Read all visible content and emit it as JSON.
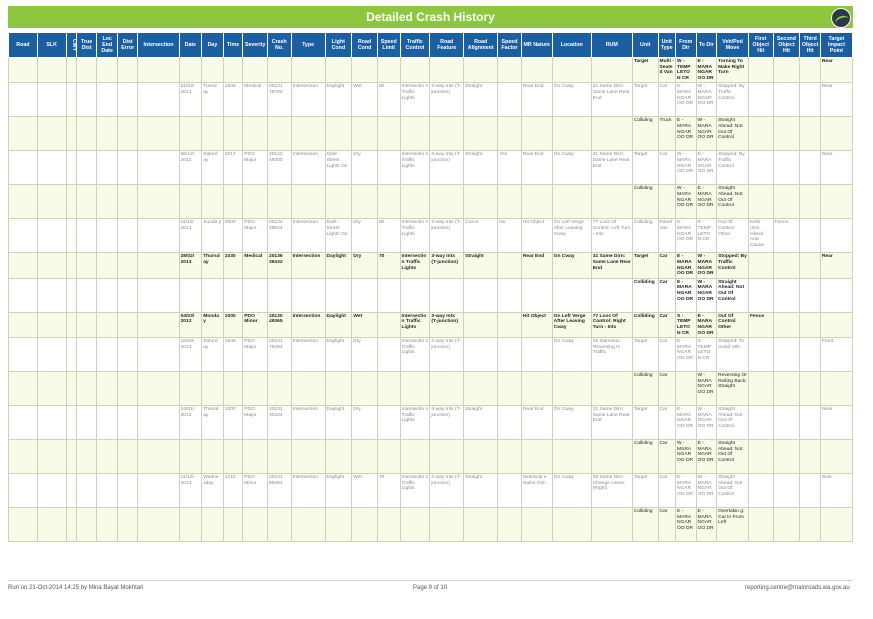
{
  "title": "Detailed Crash History",
  "columns": [
    "Road",
    "SLK",
    "CWY",
    "True Dist",
    "Loc End Date",
    "Dist Error",
    "Intersection",
    "Date",
    "Day",
    "Time",
    "Severity",
    "Crash No.",
    "Type",
    "Light Cond",
    "Road Cond",
    "Speed Limit",
    "Traffic Control",
    "Road Feature",
    "Road Alignment",
    "Speed Factor",
    "MR Nature",
    "Location",
    "RUM",
    "Unit",
    "Unit Type",
    "From Dir",
    "To Dir",
    "Veh/Ped Move",
    "First Object Hit",
    "Second Object Hit",
    "Third Object Hit",
    "Target Impact Point"
  ],
  "rows": [
    {
      "kind": "hl",
      "cells": [
        "",
        "",
        "",
        "",
        "",
        "",
        "",
        "",
        "",
        "",
        "",
        "",
        "",
        "",
        "",
        "",
        "",
        "",
        "",
        "",
        "",
        "",
        "",
        "Target",
        "Multi - Seated Van",
        "W - TEMP LETO N CR",
        "E - MARA NGAR OO DR",
        "Turning To Make Right Turn",
        "",
        "",
        "",
        "Rear"
      ]
    },
    {
      "kind": "main",
      "cells": [
        "",
        "",
        "",
        "",
        "",
        "",
        "",
        "21/03/ 2013",
        "Tuesd ay",
        "1645",
        "Medical",
        "20131 79792",
        "Intersection",
        "Daylight",
        "Wet",
        "60",
        "Intersectio n Traffic Lights",
        "3-way Intx (T-junction)",
        "Straight",
        "",
        "Rear End",
        "On Cway",
        "31 Same Dirn: Same Lane Rear End",
        "Target",
        "Car",
        "E - MARA NGAR OO DR",
        "W - MARA NGAR OO DR",
        "Stopped: By Traffic Control",
        "",
        "",
        "",
        "Rear"
      ]
    },
    {
      "kind": "alt",
      "cells": [
        "",
        "",
        "",
        "",
        "",
        "",
        "",
        "",
        "",
        "",
        "",
        "",
        "",
        "",
        "",
        "",
        "",
        "",
        "",
        "",
        "",
        "",
        "",
        "Colliding",
        "Truck",
        "E - MARA NGAR OO DR",
        "W - MARA NGAR OO DR",
        "Straight Ahead: Not Out Of Control",
        "",
        "",
        "",
        ""
      ]
    },
    {
      "kind": "main",
      "cells": [
        "",
        "",
        "",
        "",
        "",
        "",
        "",
        "06/12/ 2012",
        "Saturd ay",
        "2017",
        "PDO Major",
        "20122 48400",
        "Intersection",
        "Dark - Street Lights On",
        "Dry",
        "",
        "Intersectio n Traffic Lights",
        "3-way Intx (T-junction)",
        "Straight",
        "Yes",
        "Rear End",
        "On Cway",
        "31 Same Dirn: Same Lane Rear End",
        "Target",
        "Car",
        "W - MARA NGAR OO DR",
        "E - MARA NGAR OO DR",
        "Stopped: By Traffic Control",
        "",
        "",
        "",
        "Rear"
      ]
    },
    {
      "kind": "alt",
      "cells": [
        "",
        "",
        "",
        "",
        "",
        "",
        "",
        "",
        "",
        "",
        "",
        "",
        "",
        "",
        "",
        "",
        "",
        "",
        "",
        "",
        "",
        "",
        "",
        "Colliding",
        "",
        "W - MARA NGAR OO DR",
        "E - MARA NGAR OO DR",
        "Straight Ahead: Not Out Of Control",
        "",
        "",
        "",
        ""
      ]
    },
    {
      "kind": "main",
      "cells": [
        "",
        "",
        "",
        "",
        "",
        "",
        "",
        "11/10/ 2013",
        "Sunda y",
        "0000",
        "PDO Major",
        "20132 29644",
        "Intersection",
        "Dark - Street Lights On",
        "Dry",
        "60",
        "Intersectio n Traffic Lights",
        "3-way Intx (T-junction)",
        "Curve",
        "No",
        "Hit Object",
        "On Left Verge After Leaving Cway",
        "77 Loss Of Control: Left Turn - Intx",
        "Colliding",
        "Panel Van",
        "E - MARA NGAR OO DR",
        "S - TEMP LETO N CR",
        "Out Of Control Other",
        "Kerb (Incl. Island And Cause",
        "Fence",
        "",
        ""
      ]
    },
    {
      "kind": "hl",
      "cells": [
        "",
        "",
        "",
        "",
        "",
        "",
        "",
        "28/02/ 2013",
        "Thursd ay",
        "1030",
        "Medical",
        "20136 39432",
        "Intersection",
        "Daylight",
        "Dry",
        "70",
        "Intersectio n Traffic Lights",
        "3-way Intx (T-junction)",
        "Straight",
        "",
        "Rear End",
        "On Cway",
        "31 Same Dirn: Same Lane Rear End",
        "Target",
        "Car",
        "E - MARA NGAR OO DR",
        "W - MARA NGAR OO DR",
        "Stopped: By Traffic Control",
        "",
        "",
        "",
        "Rear"
      ]
    },
    {
      "kind": "main unit",
      "cells": [
        "",
        "",
        "",
        "",
        "",
        "",
        "",
        "",
        "",
        "",
        "",
        "",
        "",
        "",
        "",
        "",
        "",
        "",
        "",
        "",
        "",
        "",
        "",
        "Colliding",
        "Car",
        "E - MARA NGAR OO DR",
        "W - MARA NGAR OO DR",
        "Straight Ahead: Not Out Of Control",
        "",
        "",
        "",
        ""
      ]
    },
    {
      "kind": "hl",
      "cells": [
        "",
        "",
        "",
        "",
        "",
        "",
        "",
        "04/03/ 2013",
        "Monda y",
        "1000",
        "PDO Minor",
        "20130 49365",
        "Intersection",
        "Daylight",
        "Wet",
        "",
        "Intersectio n Traffic Lights",
        "3-way Intx (T-junction)",
        "",
        "",
        "Hit Object",
        "On Left Verge After Leaving Cway",
        "77 Loss Of Control: Right Turn - Intx",
        "Colliding",
        "Car",
        "S - TEMP LETO N CR",
        "E - MARA NGAR OO DR",
        "Out Of Control Other",
        "Fence",
        "",
        "",
        ""
      ]
    },
    {
      "kind": "main",
      "cells": [
        "",
        "",
        "",
        "",
        "",
        "",
        "",
        "15/09/ 2013",
        "Saturd ay",
        "1645",
        "PDO Major",
        "20131 76494",
        "Intersection",
        "Daylight",
        "Dry",
        "",
        "Intersectio n Traffic Lights",
        "3-way Intx (T-junction)",
        "",
        "",
        "",
        "On Cway",
        "45 Manoeuv Reversing In Traffic",
        "Target",
        "Car",
        "E - MARA NGAR OO DR",
        "S - TEMP LETO N CR",
        "Stopped: To Avoid Veh",
        "",
        "",
        "",
        "Front"
      ]
    },
    {
      "kind": "alt",
      "cells": [
        "",
        "",
        "",
        "",
        "",
        "",
        "",
        "",
        "",
        "",
        "",
        "",
        "",
        "",
        "",
        "",
        "",
        "",
        "",
        "",
        "",
        "",
        "",
        "Colliding",
        "Car",
        "",
        "W - MARA NGAR OO DR",
        "Reversing Or Rolling Back: Straight",
        "",
        "",
        "",
        ""
      ]
    },
    {
      "kind": "main",
      "cells": [
        "",
        "",
        "",
        "",
        "",
        "",
        "",
        "24/01/ 2013",
        "Thursd ay",
        "1000",
        "PDO Major",
        "20131 30434",
        "Intersection",
        "Daylight",
        "Dry",
        "",
        "Intersectio n Traffic Lights",
        "3-way Intx (T-junction)",
        "Straight",
        "",
        "Rear End",
        "On Cway",
        "31 Same Dirn: Same Lane Rear End",
        "Target",
        "Car",
        "E - MARA NGAR OO DR",
        "W - MARA NGAR OO DR",
        "Straight Ahead: Not Out Of Control",
        "",
        "",
        "",
        "Rear"
      ]
    },
    {
      "kind": "alt",
      "cells": [
        "",
        "",
        "",
        "",
        "",
        "",
        "",
        "",
        "",
        "",
        "",
        "",
        "",
        "",
        "",
        "",
        "",
        "",
        "",
        "",
        "",
        "",
        "",
        "Colliding",
        "Car",
        "W - MARA NGAR OO DR",
        "E - MARA NGAR OO DR",
        "Straight Ahead: Not Out Of Control",
        "",
        "",
        "",
        ""
      ]
    },
    {
      "kind": "main",
      "cells": [
        "",
        "",
        "",
        "",
        "",
        "",
        "",
        "11/10/ 2013",
        "Wedne sday",
        "1210",
        "PDO Minor",
        "20131 85491",
        "Intersection",
        "Daylight",
        "Wet",
        "70",
        "Intersectio n Traffic Lights",
        "3-way Intx (T-junction)",
        "Straight",
        "",
        "Sideswip e Same Dirn",
        "On Cway",
        "38 Same Dirn: Change Lanes (Right)",
        "Target",
        "Car",
        "E - MARA NGAR OO DR",
        "W - MARA NGAR OO DR",
        "Straight Ahead: Not Out Of Control",
        "",
        "",
        "",
        "Side"
      ]
    },
    {
      "kind": "alt",
      "cells": [
        "",
        "",
        "",
        "",
        "",
        "",
        "",
        "",
        "",
        "",
        "",
        "",
        "",
        "",
        "",
        "",
        "",
        "",
        "",
        "",
        "",
        "",
        "",
        "Colliding",
        "Car",
        "E - MARA NGAR OO DR",
        "E - MARA NGAR OO DR",
        "Overtakin g: Cut In From Left",
        "",
        "",
        "",
        ""
      ]
    }
  ],
  "footer": {
    "run_info": "Run on 21-Oct-2014 14:25 by Mina Bayat Mokhtari",
    "page": "Page 9 of 10",
    "email": "reporting.centre@mainroads.wa.gov.au"
  },
  "colors": {
    "accent": "#8dc63f",
    "header": "#1c5fa0",
    "row_alt": "#f8fbe7"
  },
  "icons": {
    "logo": "main-roads-logo"
  }
}
